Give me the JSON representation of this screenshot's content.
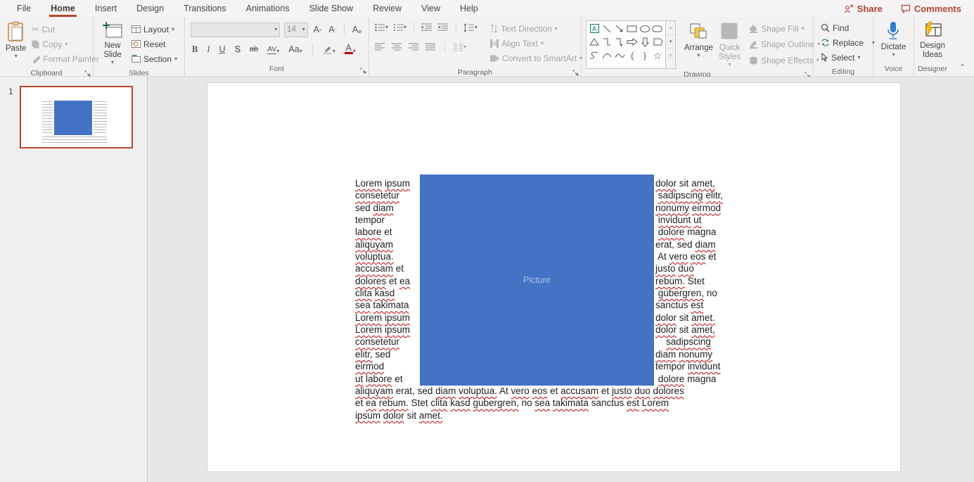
{
  "menu": {
    "tabs": [
      "File",
      "Home",
      "Insert",
      "Design",
      "Transitions",
      "Animations",
      "Slide Show",
      "Review",
      "View",
      "Help"
    ],
    "active_tab": "Home",
    "share_label": "Share",
    "comments_label": "Comments"
  },
  "ribbon": {
    "clipboard": {
      "label": "Clipboard",
      "paste": "Paste",
      "cut": "Cut",
      "copy": "Copy",
      "format_painter": "Format Painter"
    },
    "slides": {
      "label": "Slides",
      "new_slide": "New Slide",
      "layout": "Layout",
      "reset": "Reset",
      "section": "Section"
    },
    "font": {
      "label": "Font",
      "size_value": "14",
      "bold": "B",
      "italic": "I",
      "underline": "U",
      "shadow": "S",
      "strikethrough": "ab",
      "char_spacing": "AV",
      "change_case": "Aa",
      "font_color_letter": "A"
    },
    "paragraph": {
      "label": "Paragraph",
      "text_direction": "Text Direction",
      "align_text": "Align Text",
      "convert_smartart": "Convert to SmartArt"
    },
    "drawing": {
      "label": "Drawing",
      "textbox_letter": "A",
      "arrange": "Arrange",
      "quick_styles": "Quick Styles",
      "shape_fill": "Shape Fill",
      "shape_outline": "Shape Outline",
      "shape_effects": "Shape Effects"
    },
    "editing": {
      "label": "Editing",
      "find": "Find",
      "replace": "Replace",
      "select": "Select"
    },
    "voice": {
      "label": "Voice",
      "dictate": "Dictate"
    },
    "designer": {
      "label": "Designer",
      "design_ideas_line1": "Design",
      "design_ideas_line2": "Ideas"
    }
  },
  "icons": {
    "cut_glyph": "✂",
    "caret_glyph": "▾",
    "brace_left": "{",
    "brace_right": "}",
    "star_glyph": "☆",
    "collapse_chevron": "⌃"
  },
  "slide_panel": {
    "slide_number": "1"
  },
  "slide": {
    "picture_label": "Picture",
    "left_column_lines": [
      "Lorem ipsum",
      "consetetur",
      "sed diam",
      "tempor",
      "labore et",
      "aliquyam",
      "voluptua.",
      "accusam et",
      "dolores et ea",
      "clita kasd",
      "sea takimata",
      "Lorem ipsum",
      "Lorem ipsum",
      "consetetur",
      "elitr, sed",
      "eirmod",
      "ut labore et"
    ],
    "right_column_lines": [
      "dolor sit amet,",
      " sadipscing elitr,",
      "nonumy eirmod",
      " invidunt ut",
      " dolore magna",
      "erat, sed diam",
      " At vero eos et",
      "justo duo",
      "rebum. Stet",
      " gubergren, no",
      "sanctus est",
      "dolor sit amet.",
      "dolor sit amet,",
      "    sadipscing",
      "diam nonumy",
      "tempor invidunt",
      " dolore magna"
    ],
    "bottom_lines": [
      "aliquyam erat, sed diam voluptua. At vero eos et accusam et justo duo dolores",
      "et ea rebum. Stet clita kasd gubergren, no sea takimata sanctus est Lorem",
      "ipsum dolor sit amet."
    ],
    "spellcheck_ok_words": [
      "et",
      "sit",
      "At",
      "no",
      "sed",
      "tempor",
      "magna",
      "erat",
      "Stet",
      "sanctus"
    ]
  },
  "colors": {
    "accent_red": "#b7472a",
    "share_red": "#b34435",
    "picture_blue": "#4472c4",
    "squiggle_red": "#c00000",
    "dictate_blue": "#2b7cd3",
    "designer_yellow": "#ffb900"
  }
}
